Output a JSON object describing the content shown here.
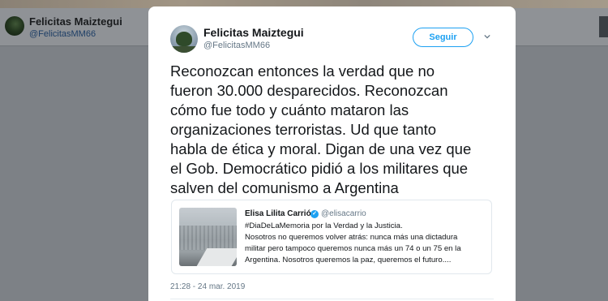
{
  "background_profile": {
    "name": "Felicitas Maiztegui",
    "handle": "@FelicitasMM66"
  },
  "tweet": {
    "author_name": "Felicitas Maiztegui",
    "author_handle": "@FelicitasMM66",
    "follow_label": "Seguir",
    "text": "Reconozcan entonces la verdad que no\nfueron 30.000 desparecidos. Reconozcan\ncómo fue todo y cuánto mataron las\norganizaciones terroristas. Ud que tanto\nhabla de ética y moral. Digan de una vez que\nel Gob. Democrático pidió a los militares que\nsalven del comunismo a Argentina",
    "timestamp": "21:28 - 24 mar. 2019"
  },
  "quoted_tweet": {
    "author_name": "Elisa Lilita Carrió",
    "author_handle": "@elisacarrio",
    "text": "#DiaDeLaMemoria por la Verdad y la Justicia.\nNosotros no queremos volver atrás: nunca más una dictadura\nmilitar pero tampoco queremos nunca más un 74 o un 75 en la\nArgentina. Nosotros queremos la paz, queremos el futuro...."
  },
  "icons": {
    "chevron": "chevron-down-icon",
    "verified": "verified-badge-icon"
  },
  "colors": {
    "accent": "#1da1f2",
    "overlay": "#7d8186",
    "text_primary": "#14171a",
    "text_secondary": "#657786"
  }
}
